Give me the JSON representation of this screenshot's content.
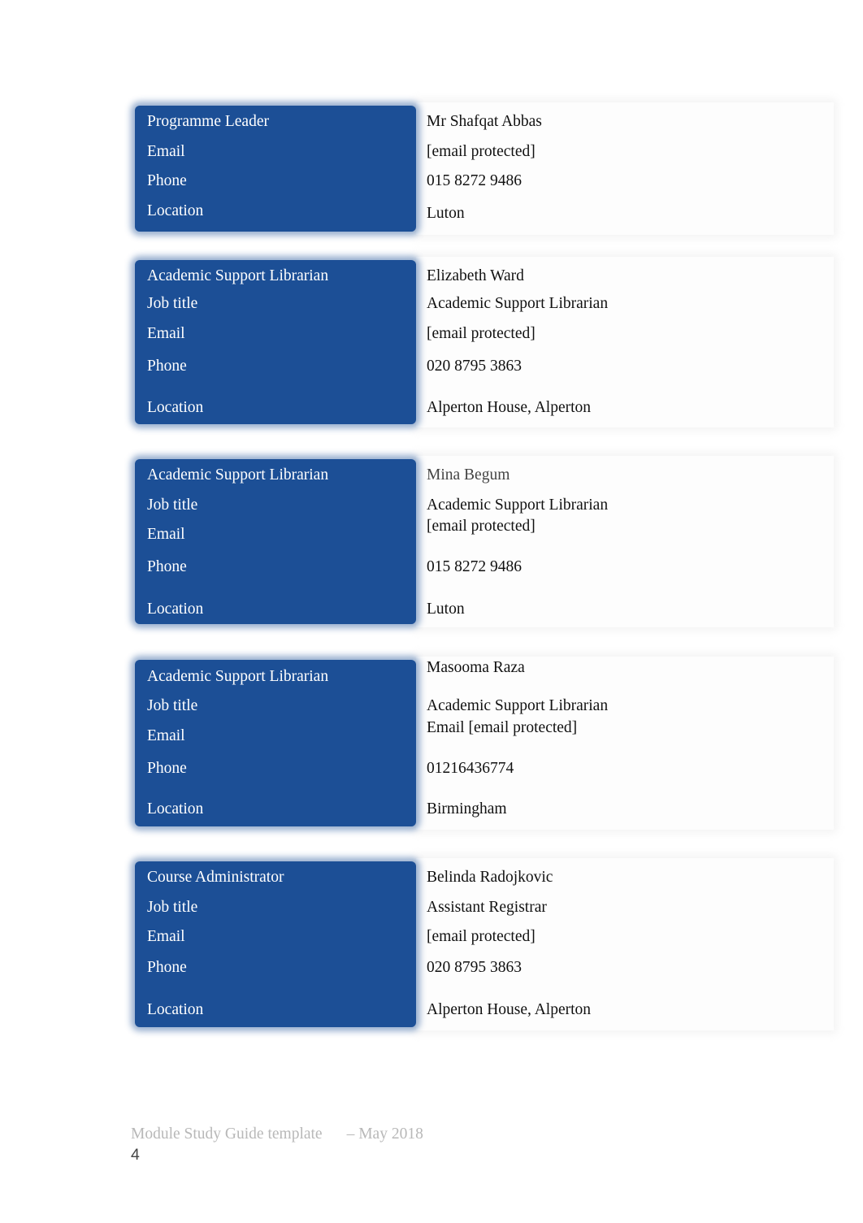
{
  "contacts": [
    {
      "rows": [
        {
          "label": "Programme Leader",
          "value": "Mr Shafqat Abbas"
        },
        {
          "label": "Email",
          "value": "[email protected]"
        },
        {
          "label": "Phone",
          "value": "015 8272 9486"
        },
        {
          "label": "Location",
          "value": "Luton"
        }
      ]
    },
    {
      "rows": [
        {
          "label": "Academic Support Librarian",
          "value": "Elizabeth Ward"
        },
        {
          "label": "Job title",
          "value": "Academic Support Librarian"
        },
        {
          "label": "Email",
          "value": "[email protected]"
        },
        {
          "label": "Phone",
          "value": "020 8795 3863"
        },
        {
          "label": "Location",
          "value": "Alperton House, Alperton"
        }
      ]
    },
    {
      "rows": [
        {
          "label": "Academic Support Librarian",
          "value": "Mina Begum"
        },
        {
          "label": "Job title",
          "value": "Academic Support Librarian"
        },
        {
          "label": "Email",
          "value": "[email protected]"
        },
        {
          "label": "Phone",
          "value": "015 8272 9486"
        },
        {
          "label": "Location",
          "value": "Luton"
        }
      ]
    },
    {
      "rows": [
        {
          "label": "Academic Support Librarian",
          "value": "Masooma Raza"
        },
        {
          "label": "Job title",
          "value": "Academic Support Librarian"
        },
        {
          "label": "Email",
          "value": "Email [email protected]"
        },
        {
          "label": "Phone",
          "value": "01216436774"
        },
        {
          "label": "Location",
          "value": "Birmingham"
        }
      ]
    },
    {
      "rows": [
        {
          "label": "Course Administrator",
          "value": "Belinda Radojkovic"
        },
        {
          "label": "Job title",
          "value": "Assistant Registrar"
        },
        {
          "label": "Email",
          "value": "[email protected]"
        },
        {
          "label": "Phone",
          "value": "020 8795 3863"
        },
        {
          "label": "Location",
          "value": "Alperton House, Alperton"
        }
      ]
    }
  ],
  "footer": {
    "title": "Module Study Guide template",
    "date": "– May 2018",
    "page_number": "4"
  }
}
